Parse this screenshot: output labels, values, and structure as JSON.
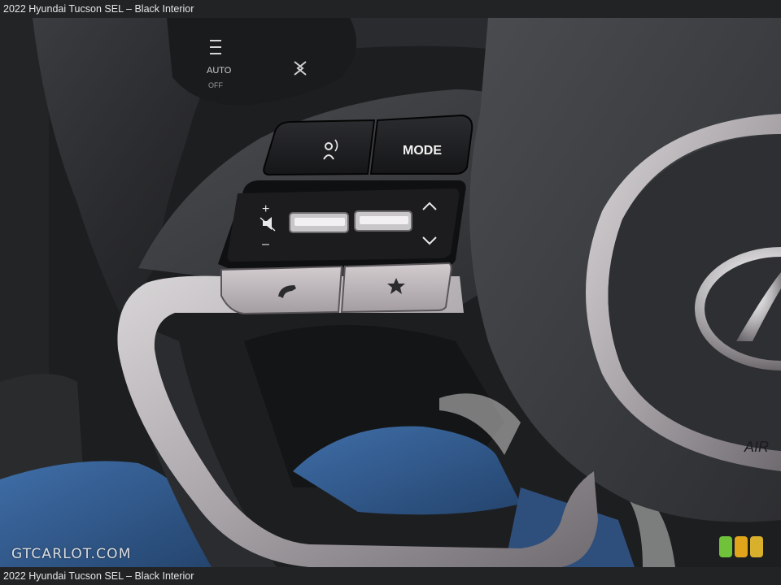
{
  "caption": {
    "top": "2022 Hyundai Tucson SEL – Black Interior",
    "bottom": "2022 Hyundai Tucson SEL – Black Interior"
  },
  "watermark": "GTCARLOT.COM",
  "wheel_buttons": {
    "mode_label": "MODE",
    "stalk_auto_label": "AUTO",
    "stalk_off_label": "OFF",
    "plus_label": "+",
    "minus_label": "–",
    "voice_icon": "voice-command-icon",
    "mute_icon": "mute-icon",
    "phone_icon": "phone-icon",
    "star_icon": "star-icon"
  },
  "rating_lights": {
    "colors": [
      "#6fc23a",
      "#e1a51c",
      "#d9b02c"
    ]
  }
}
